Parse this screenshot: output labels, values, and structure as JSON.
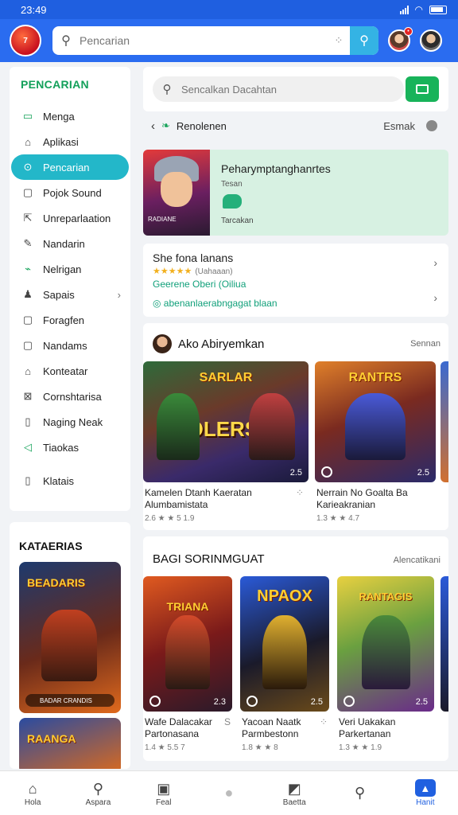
{
  "status": {
    "time": "23:49"
  },
  "appbar": {
    "logo_text": "7",
    "search_placeholder": "Pencarian"
  },
  "sidebar": {
    "title": "PENCARIAN",
    "items": [
      {
        "label": "Menga",
        "icon": "folder-icon",
        "glyph": "▭"
      },
      {
        "label": "Aplikasi",
        "icon": "home-icon",
        "glyph": "⌂"
      },
      {
        "label": "Pencarian",
        "icon": "search-icon",
        "glyph": "⊙"
      },
      {
        "label": "Pojok Sound",
        "icon": "square-icon",
        "glyph": "▢"
      },
      {
        "label": "Unreparlaation",
        "icon": "share-icon",
        "glyph": "⇱"
      },
      {
        "label": "Nandarin",
        "icon": "pen-icon",
        "glyph": "✎"
      },
      {
        "label": "Nelrigan",
        "icon": "chart-icon",
        "glyph": "⌁"
      },
      {
        "label": "Sapais",
        "icon": "person-icon",
        "glyph": "♟"
      },
      {
        "label": "Foragfen",
        "icon": "box-icon",
        "glyph": "▢"
      },
      {
        "label": "Nandams",
        "icon": "box-icon",
        "glyph": "▢"
      },
      {
        "label": "Konteatar",
        "icon": "house-icon",
        "glyph": "⌂"
      },
      {
        "label": "Cornshtarisa",
        "icon": "grid-icon",
        "glyph": "⊠"
      },
      {
        "label": "Naging Neak",
        "icon": "doc-icon",
        "glyph": "▯"
      },
      {
        "label": "Tiaokas",
        "icon": "arrow-left-icon",
        "glyph": "◁"
      },
      {
        "label": "Klatais",
        "icon": "book-icon",
        "glyph": "▯"
      }
    ],
    "categories_title": "KATAERIAS",
    "cat_card_1": {
      "title": "BEADARIS",
      "caption": "BADAR CRANDIS"
    },
    "cat_card_2": {
      "title": "RAANGA"
    }
  },
  "main": {
    "search_placeholder": "Sencalkan Dacahtan",
    "crumb_label": "Renolenen",
    "crumb_right": "Esmak",
    "featured": {
      "title": "Peharymptanghanrtes",
      "subtitle": "Tesan",
      "caption": "Tarcakan",
      "img_label": "RADIANE"
    },
    "detail": {
      "title": "She fona lanans",
      "stars": "★★★★★",
      "rating_note": "(Uahaaan)",
      "link1": "Geerene Oberi (Oiliua",
      "link2": "◎ abenanlaerabngagat blaan"
    },
    "section1": {
      "title": "Ako Abiryemkan",
      "more": "Sennan",
      "games": [
        {
          "title_art": "SARLAR",
          "title_big": "HOLERSIN",
          "badge": "2.5",
          "name": "Kamelen Dtanh Kaeratan",
          "sub": "Alumbamistata",
          "rating": "2.6 ★ ★ 5 1.9"
        },
        {
          "title_art": "RANTRS",
          "title_big": "",
          "badge": "2.5",
          "name": "Nerrain No Goalta Ba",
          "sub": "Karieakranian",
          "rating": "1.3 ★ ★ 4.7"
        }
      ]
    },
    "section2": {
      "title": "BAGI SORINMGUAT",
      "more": "Alencatikani",
      "games": [
        {
          "title_art": "TRIANA",
          "badge": "2.3",
          "name": "Wafe Dalacakar",
          "sub": "Partonasana",
          "rating": "1.4 ★ 5.5 7",
          "extra": "S"
        },
        {
          "title_art": "NPAOX",
          "badge": "2.5",
          "name": "Yacoan Naatk",
          "sub": "Parmbestonn",
          "rating": "1.8 ★ ★ 8",
          "extra": ""
        },
        {
          "title_art": "RANTAGIS",
          "badge": "2.5",
          "name": "Veri Uakakan",
          "sub": "Parkertanan",
          "rating": "1.3 ★ ★ 1.9",
          "extra": ""
        }
      ]
    }
  },
  "bottomnav": [
    {
      "label": "Hola",
      "icon": "home-icon",
      "glyph": "⌂"
    },
    {
      "label": "Aspara",
      "icon": "search-icon",
      "glyph": "⚲"
    },
    {
      "label": "Feal",
      "icon": "book-icon",
      "glyph": "▣"
    },
    {
      "label": "",
      "icon": "chat-icon",
      "glyph": "●"
    },
    {
      "label": "Baetta",
      "icon": "edit-icon",
      "glyph": "◩"
    },
    {
      "label": "",
      "icon": "search-icon",
      "glyph": "⚲"
    },
    {
      "label": "Hanit",
      "icon": "profile-icon",
      "glyph": "▲"
    }
  ],
  "colors": {
    "appbar": "#2a6cf0",
    "accent_teal": "#23b7c9",
    "accent_green": "#16a35a"
  }
}
